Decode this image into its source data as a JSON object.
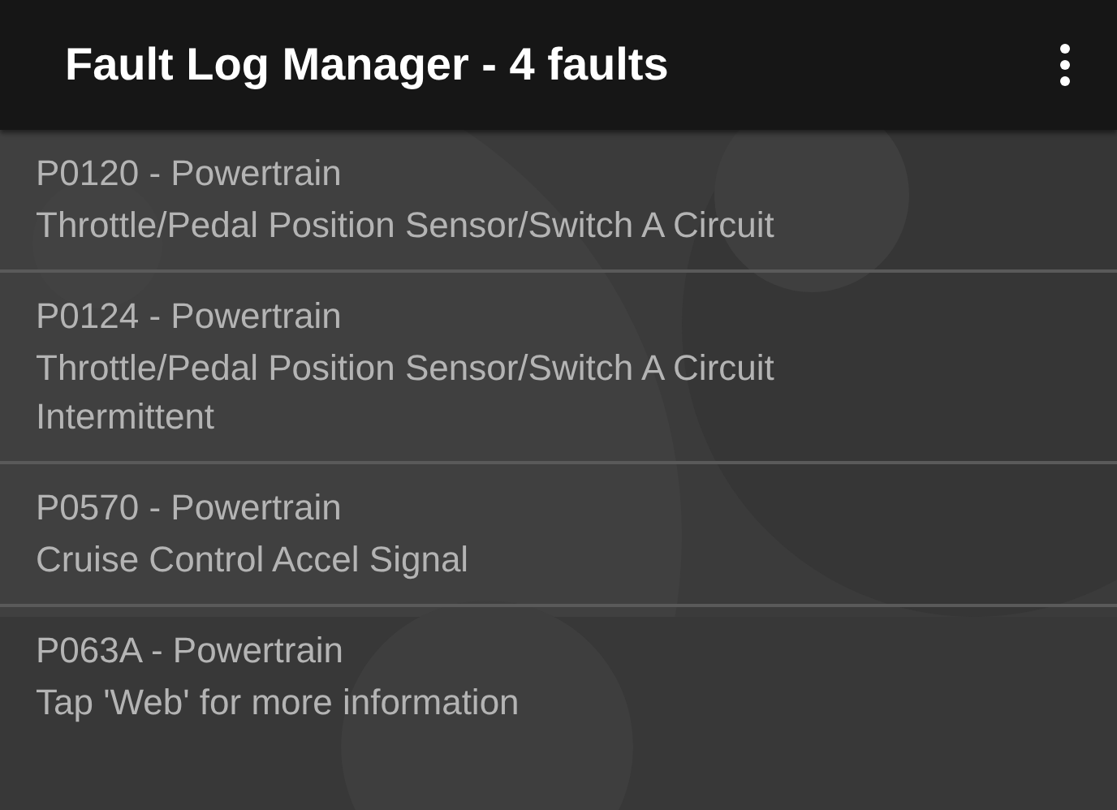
{
  "app_bar": {
    "title": "Fault Log Manager - 4 faults"
  },
  "faults": [
    {
      "code": "P0120 - Powertrain",
      "description": "Throttle/Pedal Position Sensor/Switch A Circuit"
    },
    {
      "code": "P0124 - Powertrain",
      "description": "Throttle/Pedal Position Sensor/Switch A Circuit Intermittent"
    },
    {
      "code": "P0570 - Powertrain",
      "description": "Cruise Control Accel Signal"
    },
    {
      "code": "P063A - Powertrain",
      "description": "Tap 'Web' for more information"
    }
  ]
}
